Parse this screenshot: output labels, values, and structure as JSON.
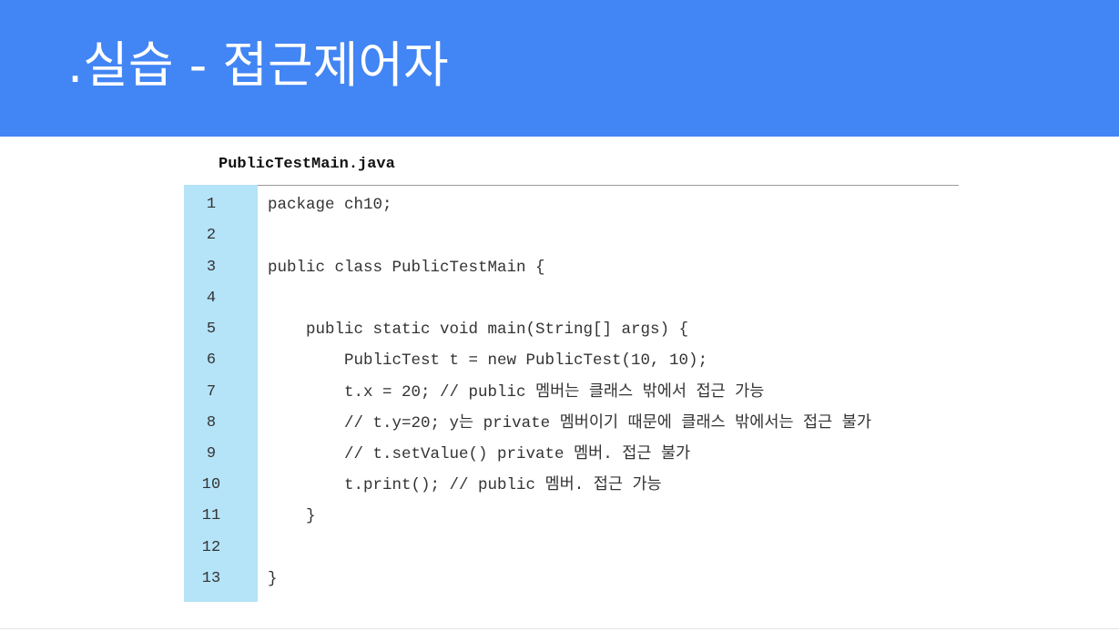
{
  "slide": {
    "title": ".실습 - 접근제어자"
  },
  "code": {
    "file_name": "PublicTestMain.java",
    "line_numbers": [
      "1",
      "2",
      "3",
      "4",
      "5",
      "6",
      "7",
      "8",
      "9",
      "10",
      "11",
      "12",
      "13"
    ],
    "lines": [
      "package ch10;",
      "",
      "public class PublicTestMain {",
      "",
      "public static void main(String[] args) {",
      "PublicTest t = new PublicTest(10, 10);",
      "t.x = 20; // public 멤버는 클래스 밖에서 접근 가능",
      "// t.y=20; y는 private 멤버이기 때문에 클래스 밖에서는 접근 불가",
      "// t.setValue() private 멤버. 접근 불가",
      "t.print(); // public 멤버. 접근 가능",
      "}",
      "",
      "}"
    ]
  },
  "colors": {
    "header_bg": "#4285f4",
    "gutter_bg": "#b5e3f8",
    "code_text": "#333333"
  }
}
